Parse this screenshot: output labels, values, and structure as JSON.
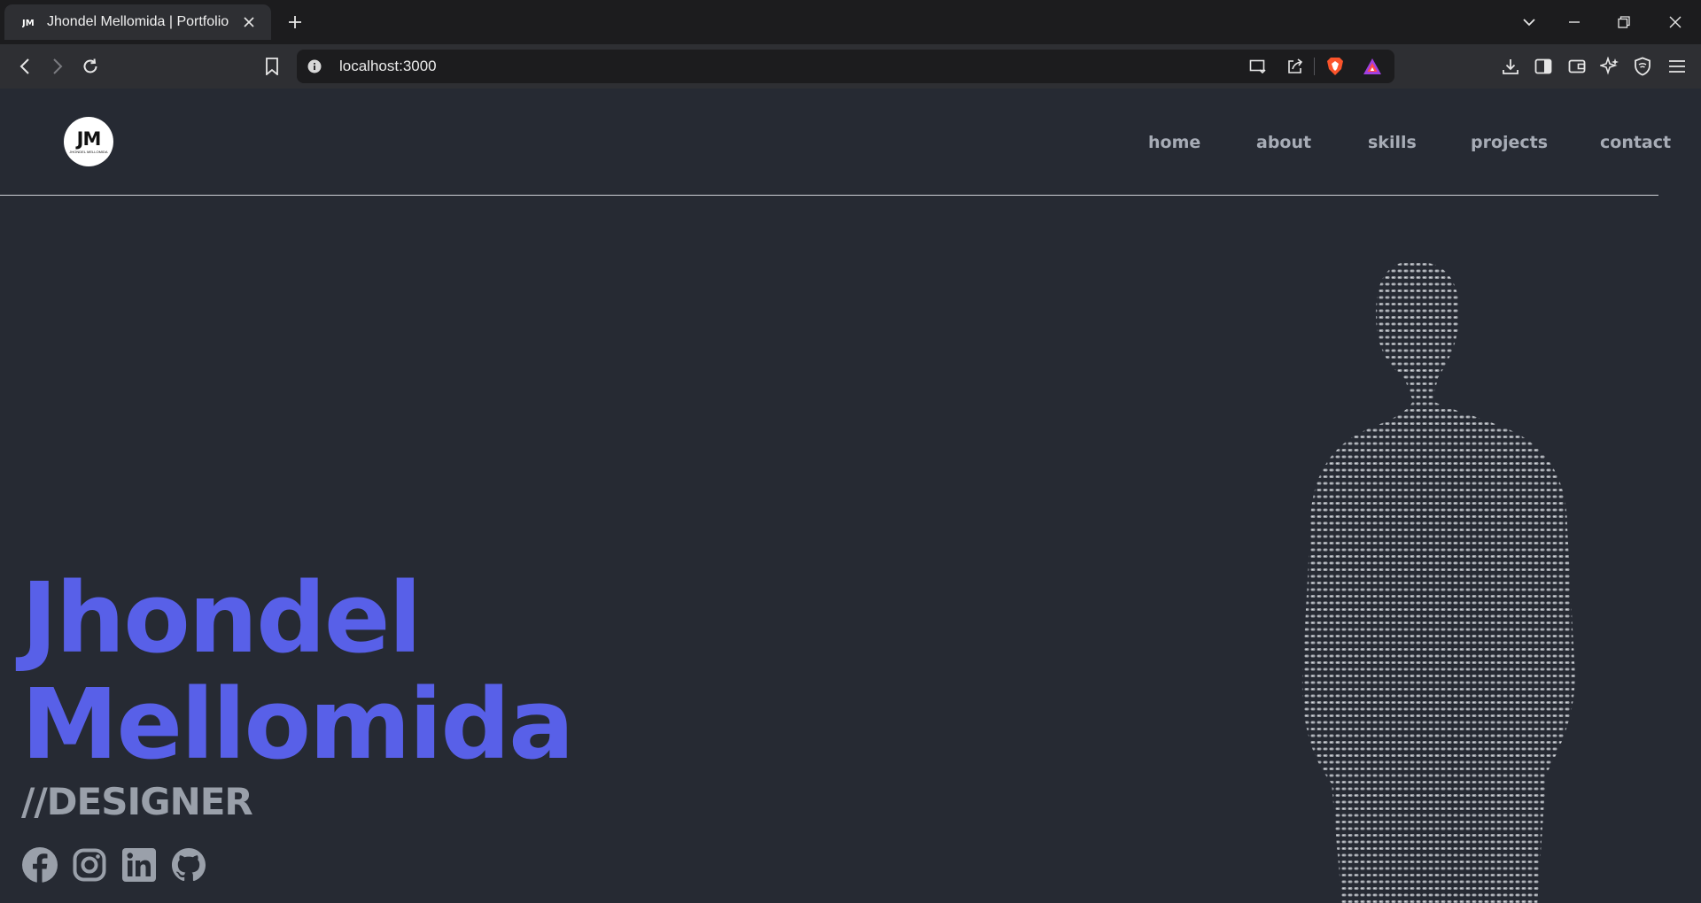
{
  "browser": {
    "tab_title": "Jhondel Mellomida | Portfolio",
    "url": "localhost:3000",
    "icons": [
      "back-arrow-icon",
      "forward-arrow-icon",
      "reload-icon",
      "bookmark-icon",
      "info-icon",
      "cast-icon",
      "share-icon",
      "brave-shields-icon",
      "brave-rewards-icon",
      "download-icon",
      "sidebar-icon",
      "wallet-icon",
      "leo-ai-icon",
      "vpn-icon",
      "menu-icon"
    ]
  },
  "site": {
    "logo_text": "JM",
    "logo_subtext": "JHONDEL MELLOMIDA",
    "nav": [
      "home",
      "about",
      "skills",
      "projects",
      "contact"
    ],
    "hero": {
      "first_name": "Jhondel",
      "last_name": "Mellomida",
      "role": "//DESIGNER"
    },
    "socials": [
      "facebook-icon",
      "instagram-icon",
      "linkedin-icon",
      "github-icon"
    ],
    "colors": {
      "background": "#262a33",
      "accent": "#5860e8",
      "muted": "#9aa0aa",
      "nav": "#a7acb6"
    }
  }
}
